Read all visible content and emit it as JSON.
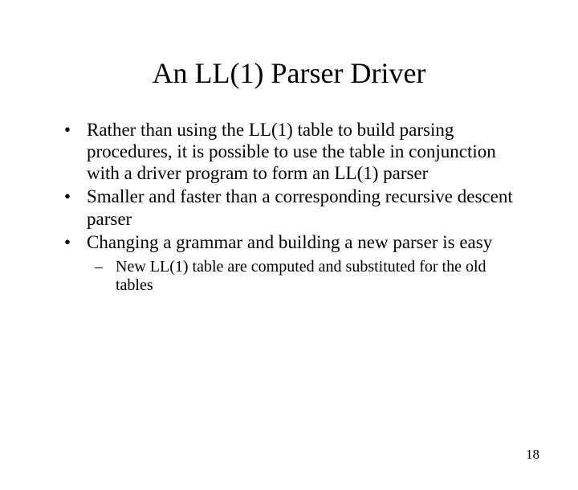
{
  "title": "An LL(1) Parser Driver",
  "bullets": [
    "Rather than using the LL(1) table to build parsing procedures, it is possible to use the table in conjunction with a driver program to form an LL(1) parser",
    "Smaller and faster than a corresponding recursive descent parser",
    "Changing a grammar and building a new parser is easy"
  ],
  "subbullets": [
    "New LL(1) table are computed and substituted for the old tables"
  ],
  "page_number": "18"
}
